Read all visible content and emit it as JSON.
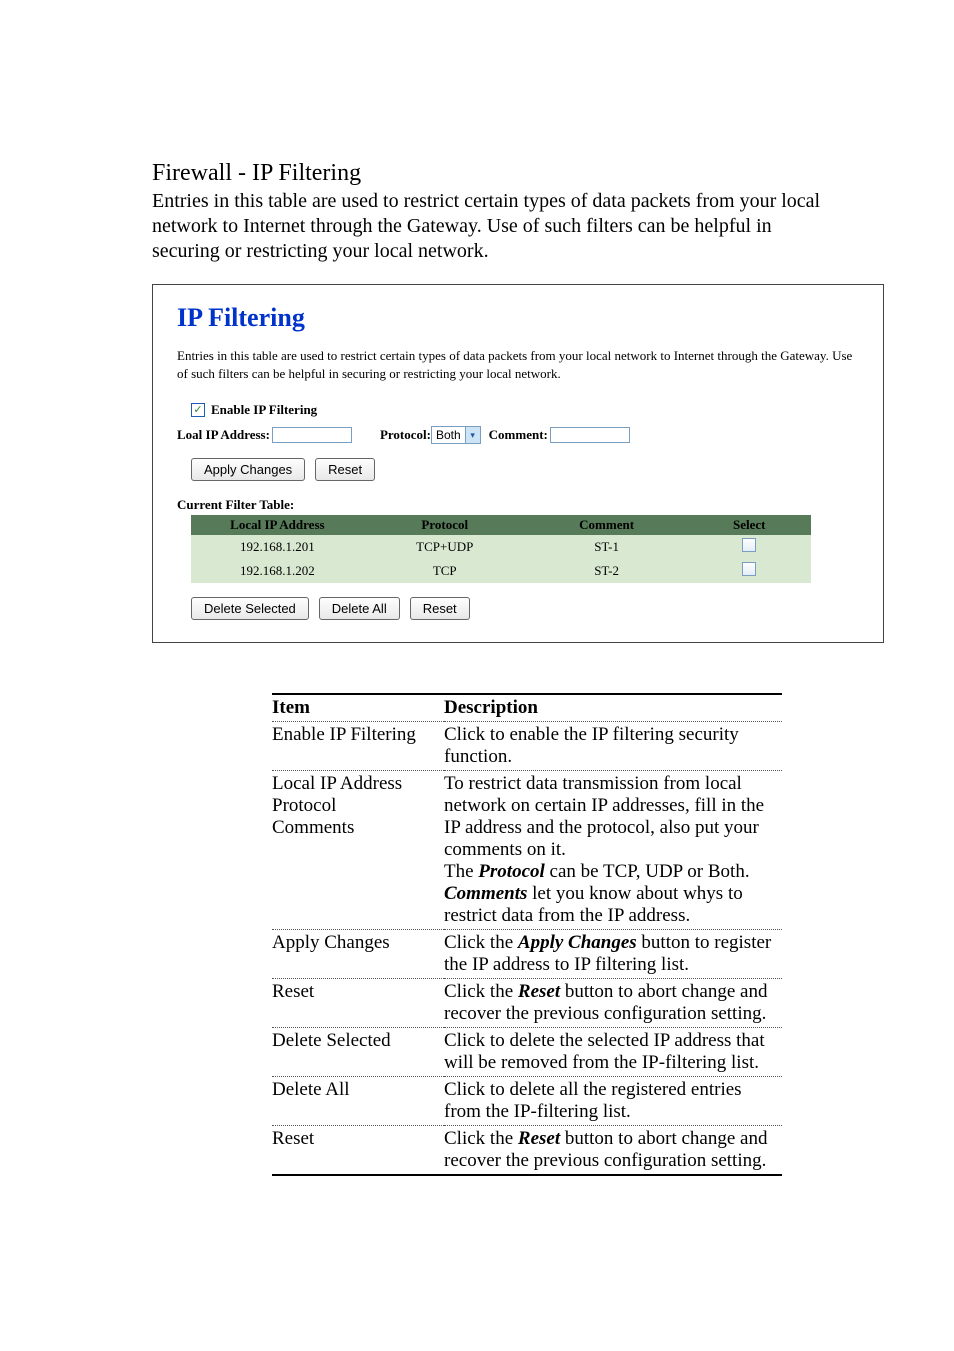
{
  "outer": {
    "title": "Firewall - IP Filtering",
    "desc": "Entries in this table are used to restrict certain types of data packets from your local network to Internet through the Gateway. Use of such filters can be helpful in securing or restricting your local network."
  },
  "panel": {
    "title": "IP Filtering",
    "desc": "Entries in this table are used to restrict certain types of data packets from your local network to Internet through the Gateway. Use of such filters can be helpful in securing or restricting your local network.",
    "enable_label": "Enable IP Filtering",
    "ip_label": "Loal IP Address:",
    "protocol_label": "Protocol:",
    "protocol_value": "Both",
    "comment_label": "Comment:",
    "apply_btn": "Apply Changes",
    "reset_btn": "Reset",
    "table_title": "Current Filter Table:",
    "headers": [
      "Local IP Address",
      "Protocol",
      "Comment",
      "Select"
    ],
    "rows": [
      {
        "ip": "192.168.1.201",
        "proto": "TCP+UDP",
        "comment": "ST-1"
      },
      {
        "ip": "192.168.1.202",
        "proto": "TCP",
        "comment": "ST-2"
      }
    ],
    "delete_selected_btn": "Delete Selected",
    "delete_all_btn": "Delete All",
    "reset2_btn": "Reset"
  },
  "desc_table": {
    "h_item": "Item",
    "h_desc": "Description",
    "r1_item": "Enable IP Filtering",
    "r1_desc": "Click to enable the IP filtering security function.",
    "r2_item_l1": "Local IP Address",
    "r2_item_l2": "Protocol",
    "r2_item_l3": "Comments",
    "r2_desc_l1": "To restrict data transmission from local network on certain IP addresses, fill in the IP address and the protocol, also put your comments on it.",
    "r2_desc_l2a": "The ",
    "r2_desc_l2b": "Protocol",
    "r2_desc_l2c": " can be TCP, UDP or Both.",
    "r2_desc_l3a": "Comments",
    "r2_desc_l3b": " let you know about whys to restrict data from the IP address.",
    "r3_item": "Apply Changes",
    "r3_desc_a": "Click the ",
    "r3_desc_b": "Apply Changes",
    "r3_desc_c": " button to register the IP address to IP filtering list.",
    "r4_item": "Reset",
    "r4_desc_a": "Click the ",
    "r4_desc_b": "Reset",
    "r4_desc_c": " button to abort change and recover the previous configuration setting.",
    "r5_item": "Delete Selected",
    "r5_desc": "Click to delete the selected IP address that will be removed from the IP-filtering list.",
    "r6_item": "Delete All",
    "r6_desc": "Click to delete all the registered entries from the IP-filtering list.",
    "r7_item": "Reset",
    "r7_desc_a": "Click the ",
    "r7_desc_b": "Reset",
    "r7_desc_c": " button to abort change and recover the previous configuration setting."
  }
}
